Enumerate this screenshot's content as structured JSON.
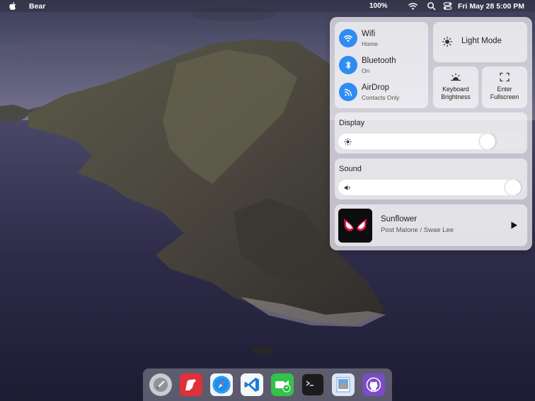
{
  "menubar": {
    "app_name": "Bear",
    "battery": "100%",
    "clock": "Fri May 28  5:00 PM",
    "icons": [
      "apple-icon",
      "wifi-icon",
      "search-icon",
      "control-center-icon"
    ]
  },
  "control_center": {
    "network": [
      {
        "title": "Wifi",
        "subtitle": "Home",
        "icon": "wifi-icon"
      },
      {
        "title": "Bluetooth",
        "subtitle": "On",
        "icon": "bluetooth-icon"
      },
      {
        "title": "AirDrop",
        "subtitle": "Contacts Only",
        "icon": "airdrop-icon"
      }
    ],
    "light_mode_label": "Light Mode",
    "keyboard_brightness_label_1": "Keyboard",
    "keyboard_brightness_label_2": "Brightness",
    "fullscreen_label_1": "Enter",
    "fullscreen_label_2": "Fullscreen",
    "display": {
      "label": "Display",
      "level": 0.83
    },
    "sound": {
      "label": "Sound",
      "level": 0.98
    },
    "now_playing": {
      "song": "Sunflower",
      "artist": "Post Malone / Swae Lee"
    }
  },
  "dock": {
    "apps": [
      "launchpad-icon",
      "bear-app-icon",
      "safari-icon",
      "vscode-icon",
      "facetime-icon",
      "terminal-icon",
      "preview-icon",
      "github-icon"
    ]
  },
  "colors": {
    "accent": "#2f8cf2"
  }
}
